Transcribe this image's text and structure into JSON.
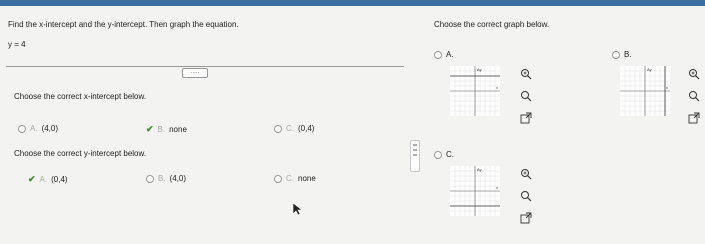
{
  "instruction": "Find the x-intercept and the y-intercept. Then graph the equation.",
  "equation": "y = 4",
  "x_question": "Choose the correct x-intercept below.",
  "x_options": [
    {
      "letter": "A.",
      "value": "(4,0)",
      "state": "radio"
    },
    {
      "letter": "B.",
      "value": "none",
      "state": "checked"
    },
    {
      "letter": "C.",
      "value": "(0,4)",
      "state": "radio"
    }
  ],
  "y_question": "Choose the correct y-intercept below.",
  "y_options": [
    {
      "letter": "A.",
      "value": "(0,4)",
      "state": "checked"
    },
    {
      "letter": "B.",
      "value": "(4,0)",
      "state": "radio"
    },
    {
      "letter": "C.",
      "value": "none",
      "state": "radio"
    }
  ],
  "graph_question": "Choose the correct graph below.",
  "graph_options": [
    {
      "letter": "A."
    },
    {
      "letter": "B."
    },
    {
      "letter": "C."
    }
  ],
  "axis_labels": {
    "x": "x",
    "y": "Ay"
  },
  "divider_handle": "....."
}
